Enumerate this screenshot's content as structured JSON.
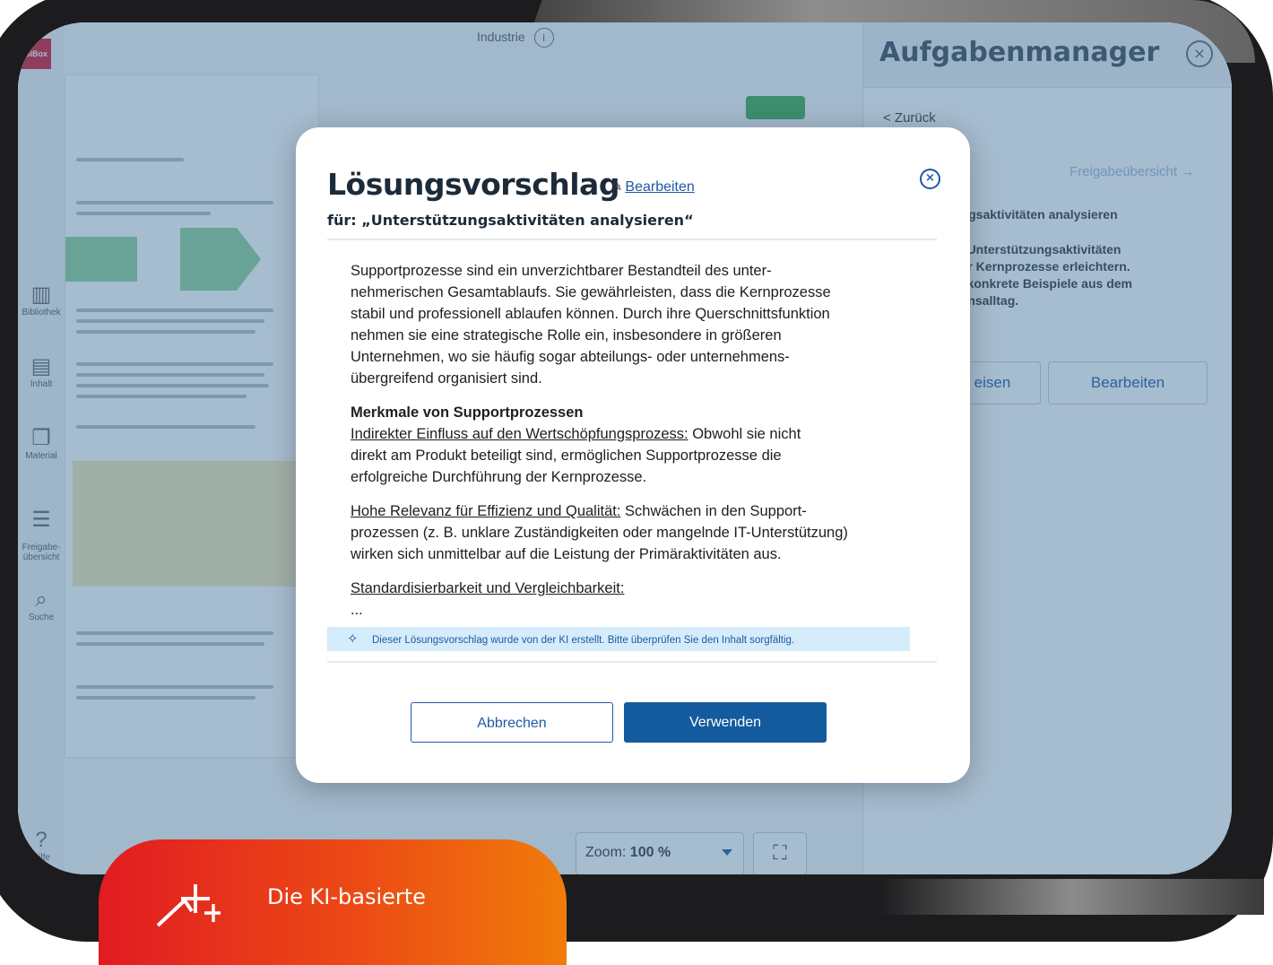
{
  "app": {
    "logo": "BiBox",
    "nav": [
      {
        "label": "Bibliothek",
        "icon": "library-icon"
      },
      {
        "label": "Inhalt",
        "icon": "contents-icon"
      },
      {
        "label": "Material",
        "icon": "material-icon"
      },
      {
        "label": "Freigabe-\nübersicht",
        "icon": "share-list-icon"
      },
      {
        "label": "Suche",
        "icon": "search-icon"
      },
      {
        "label": "Hilfe",
        "icon": "help-icon"
      }
    ],
    "document_title": "Industrie",
    "zoom_label": "Zoom:",
    "zoom_value": "100 %"
  },
  "task_panel": {
    "title": "Aufgabenmanager",
    "back_link": "< Zurück",
    "share_overview_link": "Freigabeübersicht →",
    "card_title": "ungsaktivitäten analysieren",
    "card_text": "ie Unterstützungsaktivitäten\n der Kernprozesse erleichtern.\nei konkrete Beispiele aus dem\nnensalltag.",
    "btn_assign": "eisen",
    "btn_edit": "Bearbeiten"
  },
  "modal": {
    "title": "Lösungsvorschlag",
    "edit_link": "Bearbeiten",
    "subtitle_prefix": "für:",
    "subtitle": "„Unterstützungsaktivitäten analysieren“",
    "intro": "Supportprozesse sind ein unverzichtbarer Bestandteil des unter-\nnehmerischen Gesamtablaufs. Sie gewährleisten, dass die Kernprozesse\nstabil und professionell ablaufen können. Durch ihre Querschnittsfunktion\nnehmen sie eine strategische Rolle ein, insbesondere in größeren\nUnternehmen, wo sie häufig sogar abteilungs- oder unternehmens-\nübergreifend organisiert sind.",
    "heading": "Merkmale von Supportprozessen",
    "point1_title": "Indirekter Einfluss auf den Wertschöpfungsprozess:",
    "point1_text": " Obwohl sie nicht\ndirekt am Produkt beteiligt sind, ermöglichen Supportprozesse die\nerfolgreiche Durchführung der Kernprozesse.",
    "point2_title": "Hohe Relevanz für Effizienz und Qualität:",
    "point2_text": " Schwächen in den Support-\nprozessen (z. B. unklare Zuständigkeiten oder mangelnde IT-Unterstützung)\nwirken sich unmittelbar auf die Leistung der Primäraktivitäten aus.",
    "point3_title": "Standardisierbarkeit und Vergleichbarkeit:",
    "ellipsis": "...",
    "ai_note": "Dieser Lösungsvorschlag wurde von der KI erstellt. Bitte überprüfen Sie den Inhalt sorgfältig.",
    "cancel_label": "Abbrechen",
    "use_label": "Verwenden"
  },
  "promo": {
    "text": "Die KI-basierte",
    "icon": "ai-sparkle-icon"
  },
  "colors": {
    "primary": "#135a9e",
    "link": "#1d5aa5",
    "overlay": "#3c6e96",
    "ai_note_bg": "#d5ecfa",
    "promo_start": "#e11b22",
    "promo_end": "#f07c0a"
  }
}
